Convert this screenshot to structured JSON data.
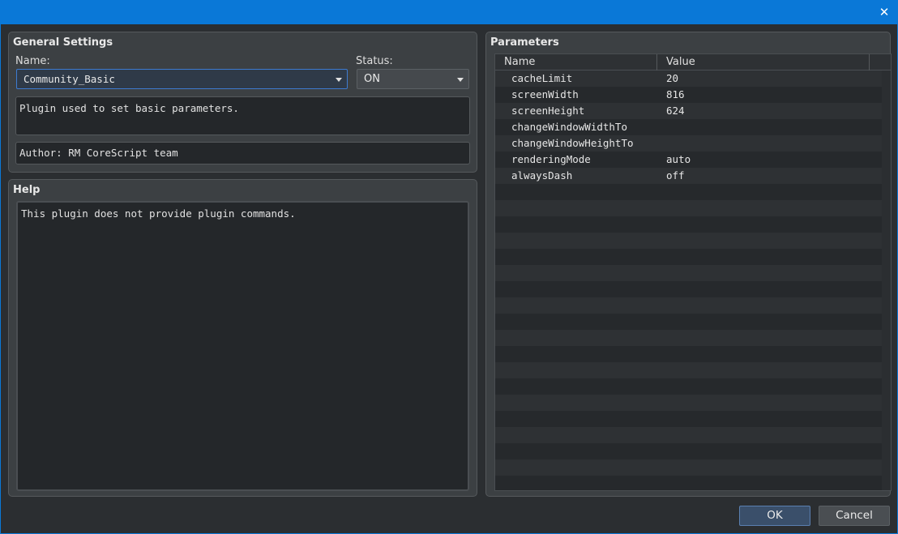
{
  "window": {
    "close_glyph": "✕"
  },
  "general": {
    "title": "General Settings",
    "name_label": "Name:",
    "name_value": "Community_Basic",
    "status_label": "Status:",
    "status_value": "ON",
    "description": "Plugin used to set basic parameters.",
    "author": "Author: RM CoreScript team"
  },
  "help": {
    "title": "Help",
    "text": "This plugin does not provide plugin commands."
  },
  "parameters": {
    "title": "Parameters",
    "columns": [
      "Name",
      "Value"
    ],
    "rows": [
      {
        "name": "cacheLimit",
        "value": "20"
      },
      {
        "name": "screenWidth",
        "value": "816"
      },
      {
        "name": "screenHeight",
        "value": "624"
      },
      {
        "name": "changeWindowWidthTo",
        "value": ""
      },
      {
        "name": "changeWindowHeightTo",
        "value": ""
      },
      {
        "name": "renderingMode",
        "value": "auto"
      },
      {
        "name": "alwaysDash",
        "value": "off"
      }
    ],
    "total_rows": 26
  },
  "buttons": {
    "ok": "OK",
    "cancel": "Cancel"
  },
  "colors": {
    "titlebar": "#0a78d7",
    "background": "#2b2e31",
    "panel": "#3c4043"
  }
}
